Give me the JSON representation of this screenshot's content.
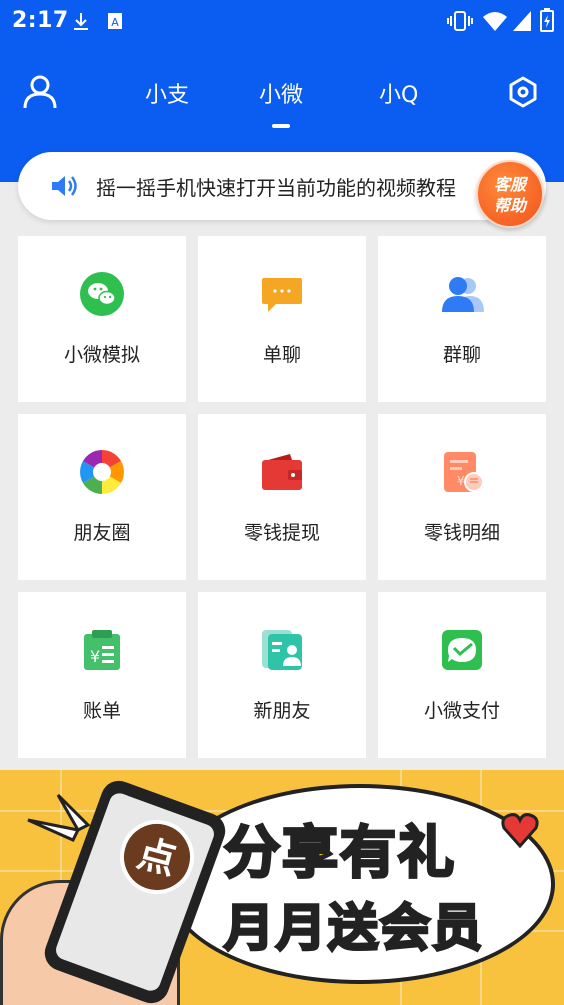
{
  "status_bar": {
    "time": "2:17",
    "icons": [
      "download-icon",
      "a-icon",
      "vibrate-icon",
      "wifi-icon",
      "signal-icon",
      "battery-icon"
    ]
  },
  "nav": {
    "tabs": [
      {
        "label": "小支",
        "active": false
      },
      {
        "label": "小微",
        "active": true
      },
      {
        "label": "小Q",
        "active": false
      }
    ],
    "left_icon": "user-icon",
    "right_icon": "settings-icon"
  },
  "notice": {
    "text": "摇一摇手机快速打开当前功能的视频教程",
    "help_badge_line1": "客服",
    "help_badge_line2": "帮助"
  },
  "grid": {
    "items": [
      {
        "label": "小微模拟",
        "icon": "wechat-icon"
      },
      {
        "label": "单聊",
        "icon": "chat-bubble-icon"
      },
      {
        "label": "群聊",
        "icon": "group-icon"
      },
      {
        "label": "朋友圈",
        "icon": "moments-icon"
      },
      {
        "label": "零钱提现",
        "icon": "wallet-icon"
      },
      {
        "label": "零钱明细",
        "icon": "receipt-icon"
      },
      {
        "label": "账单",
        "icon": "bill-icon"
      },
      {
        "label": "新朋友",
        "icon": "new-friend-icon"
      },
      {
        "label": "小微支付",
        "icon": "payment-icon"
      }
    ]
  },
  "banner": {
    "badge": "点",
    "line1": "分享有礼",
    "line2": "月月送会员"
  },
  "colors": {
    "primary_blue": "#0b5cf0",
    "green": "#2fbf4f",
    "orange": "#f2521c",
    "banner_yellow": "#f8c23f"
  }
}
